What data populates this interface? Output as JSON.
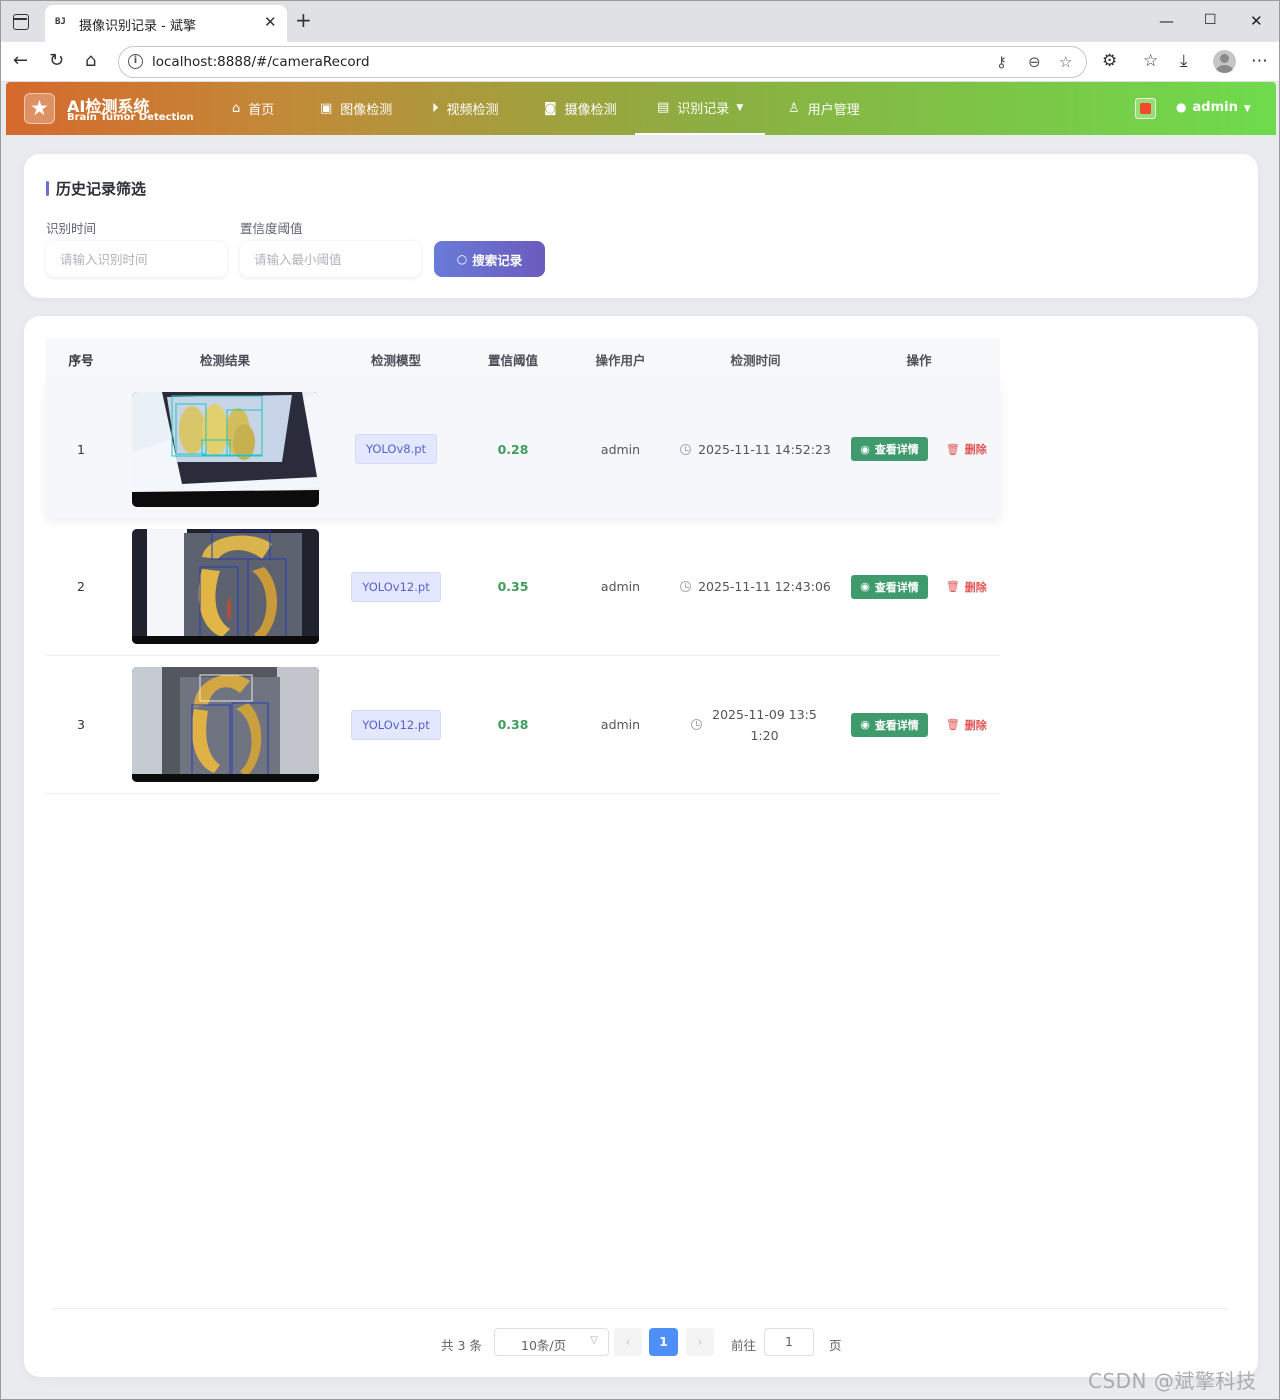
{
  "browser": {
    "tab_favicon": "BJ",
    "tab_title": "摄像识别记录 - 斌擎",
    "url": "localhost:8888/#/cameraRecord"
  },
  "app": {
    "title": "AI检测系统",
    "subtitle": "Brain Tumor Detection",
    "nav": [
      {
        "label": "首页",
        "icon": "home-icon"
      },
      {
        "label": "图像检测",
        "icon": "image-icon"
      },
      {
        "label": "视频检测",
        "icon": "play-circle-icon"
      },
      {
        "label": "摄像检测",
        "icon": "camera-icon"
      },
      {
        "label": "识别记录",
        "icon": "document-icon",
        "active": true
      },
      {
        "label": "用户管理",
        "icon": "user-icon"
      }
    ],
    "user": "admin"
  },
  "filter": {
    "title": "历史记录筛选",
    "time_label": "识别时间",
    "time_placeholder": "请输入识别时间",
    "conf_label": "置信度阈值",
    "conf_placeholder": "请输入最小阈值",
    "search_label": "搜索记录"
  },
  "table": {
    "headers": [
      "序号",
      "检测结果",
      "检测模型",
      "置信阈值",
      "操作用户",
      "检测时间",
      "操作"
    ],
    "rows": [
      {
        "index": "1",
        "model": "YOLOv8.pt",
        "conf": "0.28",
        "user": "admin",
        "time": "2025-11-11 14:52:23"
      },
      {
        "index": "2",
        "model": "YOLOv12.pt",
        "conf": "0.35",
        "user": "admin",
        "time": "2025-11-11 12:43:06"
      },
      {
        "index": "3",
        "model": "YOLOv12.pt",
        "conf": "0.38",
        "user": "admin",
        "time": "2025-11-09 13:51:20"
      }
    ],
    "detail_label": "查看详情",
    "delete_label": "删除"
  },
  "pagination": {
    "total": "共 3 条",
    "page_size": "10条/页",
    "current": "1",
    "goto_label": "前往",
    "goto_value": "1",
    "page_suffix": "页"
  },
  "watermark": "CSDN @斌擎科技",
  "colors": {
    "accent": "#6b6fd0",
    "success": "#3f9b6d",
    "danger": "#e05656",
    "primary": "#4e8ef7"
  }
}
